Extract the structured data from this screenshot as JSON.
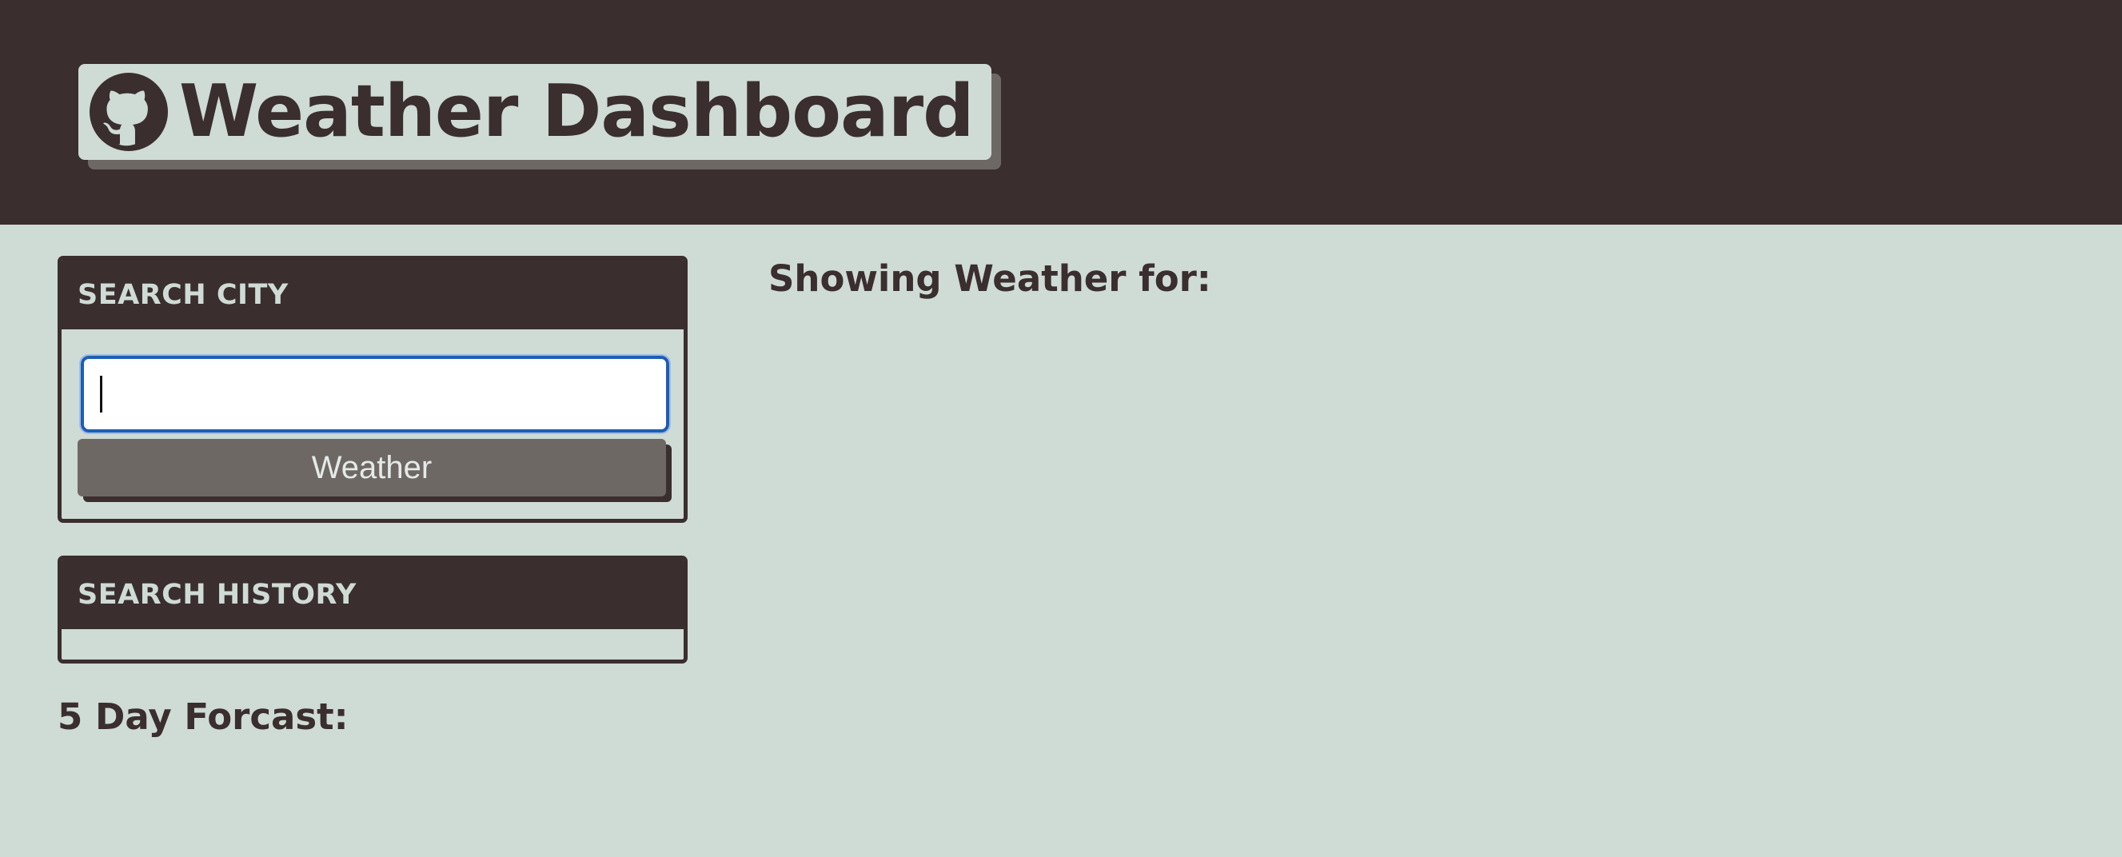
{
  "header": {
    "title": "Weather Dashboard",
    "logo_icon": "github-icon"
  },
  "search": {
    "heading": "SEARCH CITY",
    "input_value": "",
    "input_placeholder": "",
    "button_label": "Weather"
  },
  "history": {
    "heading": "SEARCH HISTORY",
    "items": []
  },
  "forecast": {
    "label": "5 Day Forcast:"
  },
  "current": {
    "label": "Showing Weather for:"
  },
  "colors": {
    "dark": "#3a2e2e",
    "background": "#cfdbd5",
    "button": "#6e6865",
    "focus_border": "#1e5eb3"
  }
}
